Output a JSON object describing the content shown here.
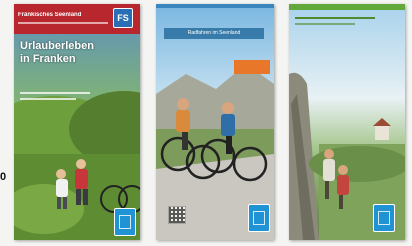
{
  "brochures": [
    {
      "header_text": "Fränkisches Seenland",
      "logo_text": "FS",
      "cover_title": "Urlauberleben in Franken"
    },
    {
      "banner_text": "Radfahren im Seenland",
      "tag_text": ""
    },
    {}
  ],
  "edge_text": "0"
}
